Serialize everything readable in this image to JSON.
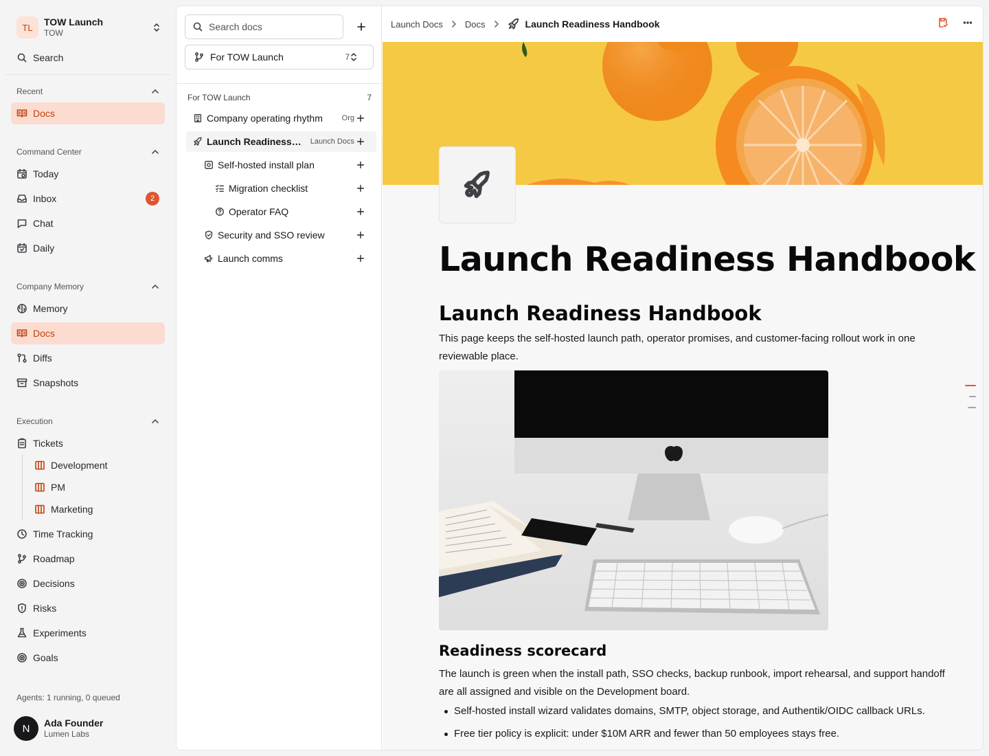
{
  "workspace": {
    "initials": "TL",
    "name": "TOW Launch",
    "sub": "TOW"
  },
  "sidebar": {
    "search_label": "Search",
    "recent": {
      "title": "Recent",
      "items": [
        {
          "label": "Docs"
        }
      ]
    },
    "command_center": {
      "title": "Command Center",
      "items": [
        {
          "label": "Today"
        },
        {
          "label": "Inbox",
          "badge": "2"
        },
        {
          "label": "Chat"
        },
        {
          "label": "Daily"
        }
      ]
    },
    "company_memory": {
      "title": "Company Memory",
      "items": [
        {
          "label": "Memory"
        },
        {
          "label": "Docs"
        },
        {
          "label": "Diffs"
        },
        {
          "label": "Snapshots"
        }
      ]
    },
    "execution": {
      "title": "Execution",
      "items": [
        {
          "label": "Tickets"
        },
        {
          "label": "Development"
        },
        {
          "label": "PM"
        },
        {
          "label": "Marketing"
        },
        {
          "label": "Time Tracking"
        },
        {
          "label": "Roadmap"
        },
        {
          "label": "Decisions"
        },
        {
          "label": "Risks"
        },
        {
          "label": "Experiments"
        },
        {
          "label": "Goals"
        }
      ]
    },
    "agents_status": "Agents: 1 running, 0 queued",
    "user": {
      "initial": "N",
      "name": "Ada Founder",
      "org": "Lumen Labs"
    }
  },
  "tree": {
    "search_placeholder": "Search docs",
    "filter": {
      "label": "For TOW Launch",
      "count": "7"
    },
    "section": {
      "title": "For TOW Launch",
      "count": "7"
    },
    "items": [
      {
        "label": "Company operating rhythm",
        "tag": "Org",
        "icon": "building-icon"
      },
      {
        "label": "Launch Readiness Handbook",
        "tag": "Launch Docs",
        "icon": "rocket-icon"
      },
      {
        "label": "Self-hosted install plan",
        "icon": "server-icon"
      },
      {
        "label": "Migration checklist",
        "icon": "checklist-icon"
      },
      {
        "label": "Operator FAQ",
        "icon": "help-circle-icon"
      },
      {
        "label": "Security and SSO review",
        "icon": "shield-icon"
      },
      {
        "label": "Launch comms",
        "icon": "megaphone-icon"
      }
    ]
  },
  "doc": {
    "breadcrumb": [
      "Launch Docs",
      "Docs",
      "Launch Readiness Handbook"
    ],
    "title": "Launch Readiness Handbook",
    "heading": "Launch Readiness Handbook",
    "intro": "This page keeps the self-hosted launch path, operator promises, and customer-facing rollout work in one reviewable place.",
    "section_heading": "Readiness scorecard",
    "section_text": "The launch is green when the install path, SSO checks, backup runbook, import rehearsal, and support handoff are all assigned and visible on the Development board.",
    "bullets": [
      "Self-hosted install wizard validates domains, SMTP, object storage, and Authentik/OIDC callback URLs.",
      "Free tier policy is explicit: under $10M ARR and fewer than 50 employees stays free."
    ]
  },
  "colors": {
    "accent": "#e0552f",
    "active_bg": "#fcdcd0",
    "cover_bg": "#f6c944"
  }
}
